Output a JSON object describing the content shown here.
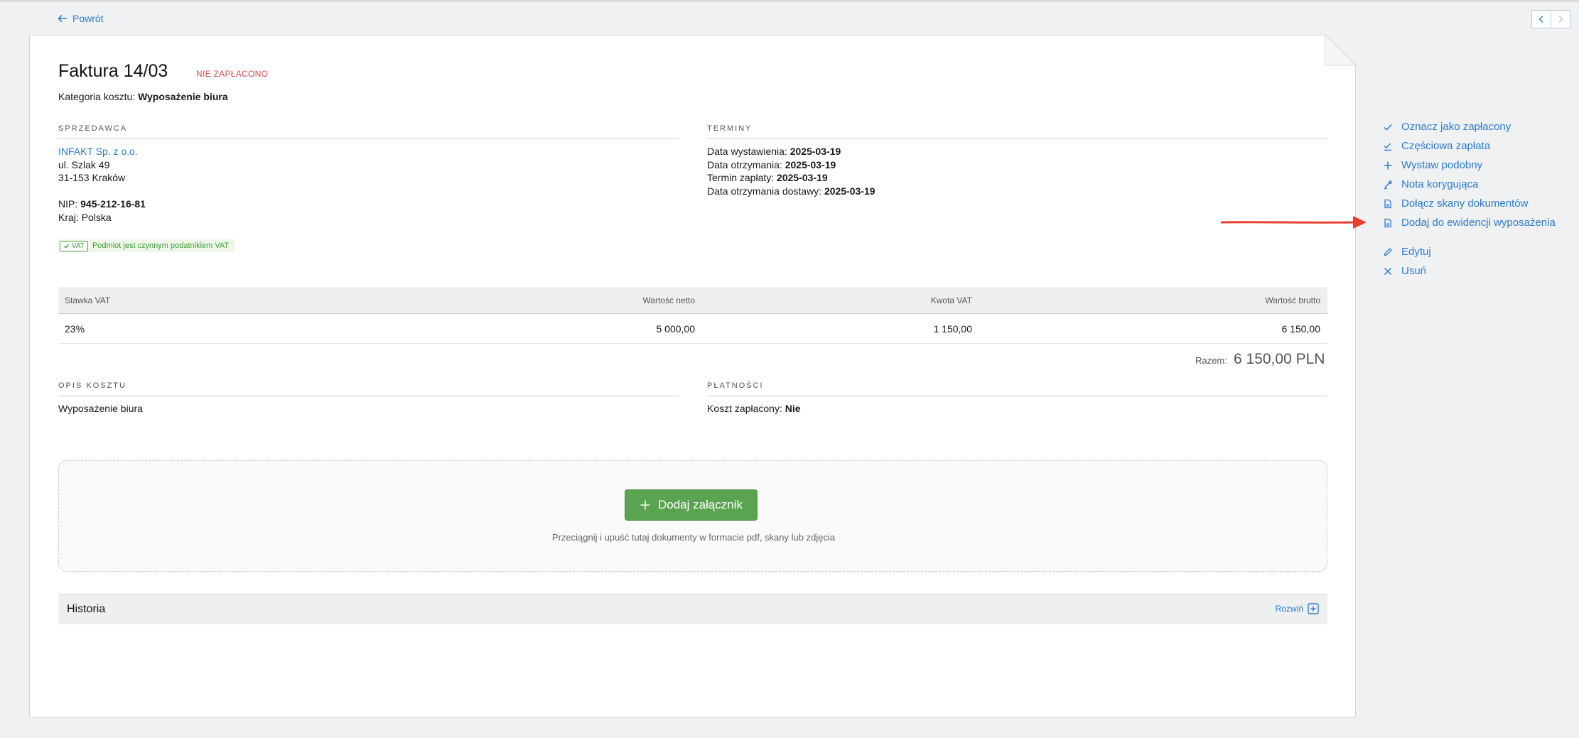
{
  "nav": {
    "back_label": "Powrót"
  },
  "invoice": {
    "title": "Faktura 14/03",
    "status": "NIE ZAPŁACONO",
    "category_label": "Kategoria kosztu:",
    "category_value": "Wyposażenie biura"
  },
  "seller": {
    "section_label": "SPRZEDAWCA",
    "name": "INFAKT Sp. z o.o.",
    "street": "ul. Szlak 49",
    "city": "31-153 Kraków",
    "nip_label": "NIP:",
    "nip_value": "945-212-16-81",
    "country_label": "Kraj:",
    "country_value": "Polska",
    "vat_tag": "VAT",
    "vat_text": "Podmiot jest czynnym podatnikiem VAT"
  },
  "terms": {
    "section_label": "TERMINY",
    "issue_label": "Data wystawienia:",
    "issue_value": "2025-03-19",
    "received_label": "Data otrzymania:",
    "received_value": "2025-03-19",
    "due_label": "Termin zapłaty:",
    "due_value": "2025-03-19",
    "delivery_label": "Data otrzymania dostawy:",
    "delivery_value": "2025-03-19"
  },
  "table": {
    "headers": [
      "Stawka VAT",
      "Wartość netto",
      "Kwota VAT",
      "Wartość brutto"
    ],
    "rows": [
      [
        "23%",
        "5 000,00",
        "1 150,00",
        "6 150,00"
      ]
    ],
    "total_label": "Razem:",
    "total_value": "6 150,00 PLN"
  },
  "description": {
    "section_label": "OPIS KOSZTU",
    "text": "Wyposażenie biura"
  },
  "payments": {
    "section_label": "PŁATNOŚCI",
    "paid_label": "Koszt zapłacony:",
    "paid_value": "Nie"
  },
  "attachments": {
    "button_label": "Dodaj załącznik",
    "hint": "Przeciągnij i upuść tutaj dokumenty w formacie pdf, skany lub zdjęcia"
  },
  "history": {
    "title": "Historia",
    "expand_label": "Rozwiń"
  },
  "actions": [
    {
      "label": "Oznacz jako zapłacony",
      "icon": "check-icon"
    },
    {
      "label": "Częściowa zapłata",
      "icon": "partial-check-icon"
    },
    {
      "label": "Wystaw podobny",
      "icon": "plus-icon"
    },
    {
      "label": "Nota korygująca",
      "icon": "correction-icon"
    },
    {
      "label": "Dołącz skany dokumentów",
      "icon": "document-icon"
    },
    {
      "label": "Dodaj do ewidencji wyposażenia",
      "icon": "document-icon"
    },
    {
      "label": "Edytuj",
      "icon": "pencil-icon"
    },
    {
      "label": "Usuń",
      "icon": "close-icon"
    }
  ],
  "colors": {
    "link": "#2b7bd4",
    "status_unpaid": "#e0474c",
    "button_green": "#5aa350",
    "annotation_arrow": "#e8412f"
  }
}
